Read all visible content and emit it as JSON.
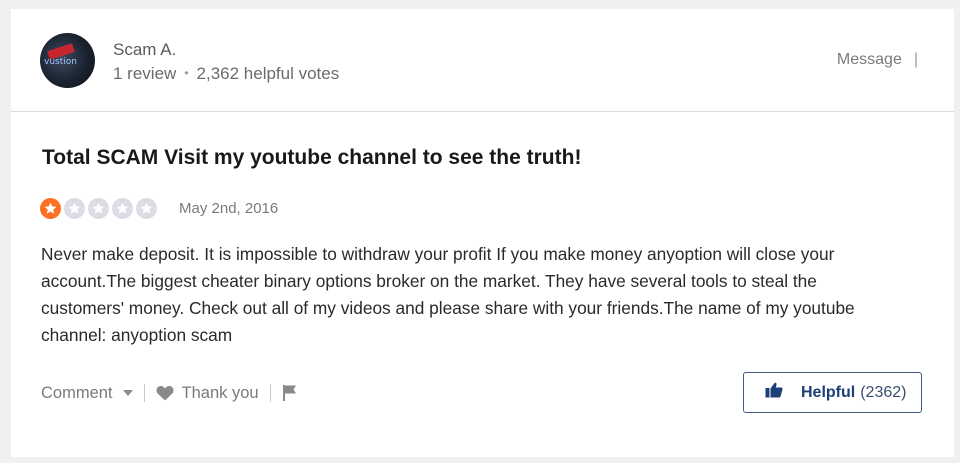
{
  "user": {
    "name": "Scam A.",
    "reviews": "1 review",
    "votes": "2,362 helpful votes",
    "avatar_text": "vustion"
  },
  "header": {
    "message_label": "Message",
    "separator": "|"
  },
  "review": {
    "title": "Total SCAM Visit my youtube channel to see the truth!",
    "rating": 1,
    "max_rating": 5,
    "date": "May 2nd, 2016",
    "body": "Never make deposit. It is impossible to withdraw your profit If you make money anyoption will close your account.The biggest cheater binary options broker on the market. They have several tools to steal the customers' money. Check out all of my videos and please share with your friends.The name of my youtube channel: anyoption scam"
  },
  "actions": {
    "comment_label": "Comment",
    "thank_label": "Thank you",
    "helpful_label": "Helpful",
    "helpful_count": "(2362)"
  },
  "colors": {
    "star_filled": "#ff7022",
    "star_empty": "#dcdce6",
    "helpful_border": "#3d5a80",
    "helpful_text": "#1c3f78"
  },
  "icons": [
    "chevron-down-icon",
    "heart-icon",
    "flag-icon",
    "thumbs-up-icon",
    "star-icon"
  ]
}
